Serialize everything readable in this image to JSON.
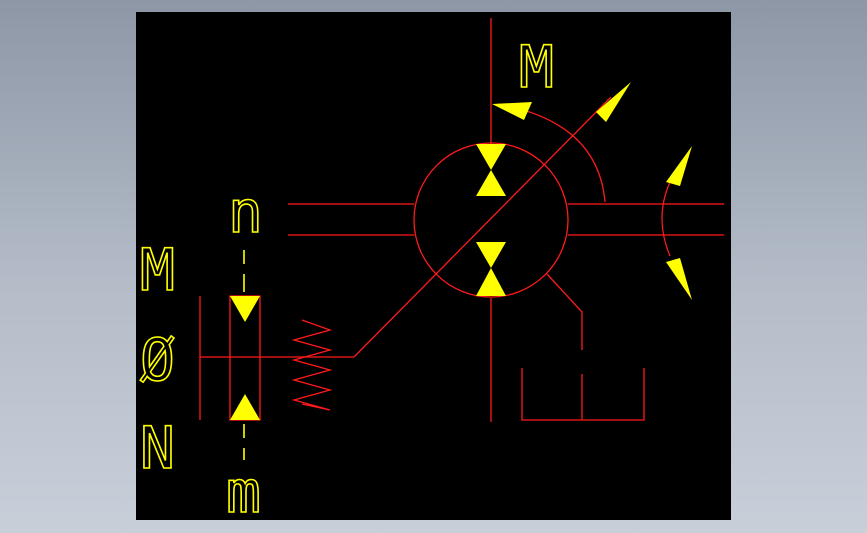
{
  "diagram": {
    "labels": {
      "motor_top": "M",
      "left_n": "n",
      "left_m": "m",
      "side_M": "M",
      "side_O": "Ø",
      "side_N": "N"
    },
    "colors": {
      "background": "#000000",
      "line": "#ff1a1a",
      "arrow": "#ffff00",
      "text": "#ffff00"
    }
  }
}
